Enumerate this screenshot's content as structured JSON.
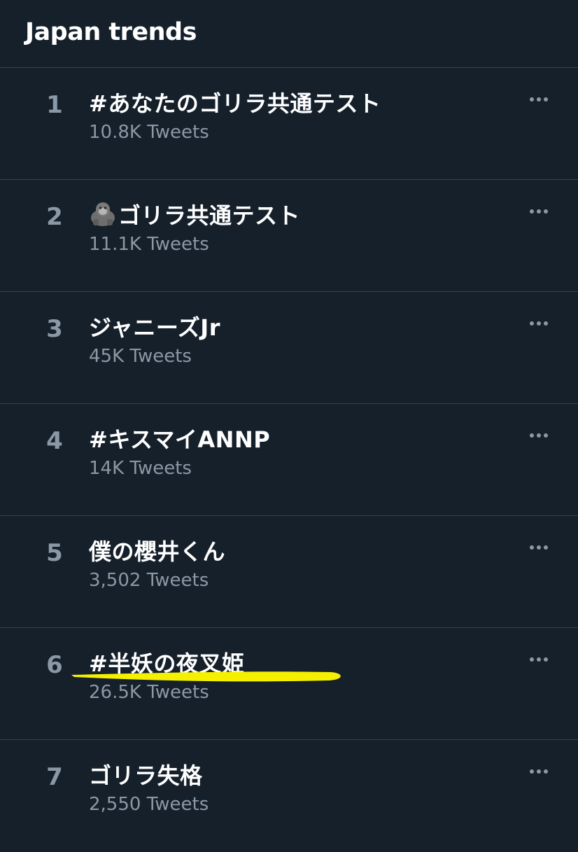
{
  "header": {
    "title": "Japan trends"
  },
  "more_icon": "more-horizontal-icon",
  "highlight_color": "#f4f000",
  "trends": [
    {
      "rank": "1",
      "name": "#あなたのゴリラ共通テスト",
      "count": "10.8K Tweets"
    },
    {
      "rank": "2",
      "emoji": "gorilla-emoji",
      "name": "ゴリラ共通テスト",
      "count": "11.1K Tweets"
    },
    {
      "rank": "3",
      "name": "ジャニーズJr",
      "count": "45K Tweets"
    },
    {
      "rank": "4",
      "name": "#キスマイANNP",
      "count": "14K Tweets"
    },
    {
      "rank": "5",
      "name": "僕の櫻井くん",
      "count": "3,502 Tweets"
    },
    {
      "rank": "6",
      "name": "#半妖の夜叉姫",
      "count": "26.5K Tweets",
      "highlighted": true
    },
    {
      "rank": "7",
      "name": "ゴリラ失格",
      "count": "2,550 Tweets"
    }
  ]
}
